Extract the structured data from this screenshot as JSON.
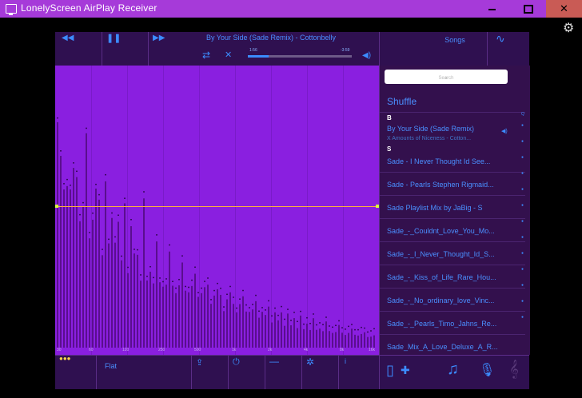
{
  "window": {
    "title": "LonelyScreen AirPlay Receiver",
    "close_label": "✕"
  },
  "player": {
    "now_playing": "By Your Side (Sade Remix) - Cottonbelly",
    "elapsed": "1:56",
    "remaining": "-3:59",
    "progress": 0.2,
    "songs_label": "Songs"
  },
  "spectrum": {
    "freq_labels": [
      "30",
      "60",
      "120",
      "250",
      "500",
      "1k",
      "2k",
      "4k",
      "8k",
      "16k"
    ]
  },
  "library": {
    "search_placeholder": "Search",
    "shuffle": "Shuffle",
    "section_b": "B",
    "section_s": "S",
    "current": {
      "title": "By Your Side (Sade Remix)",
      "subtitle": "X Amounts of Niceness - Cotton..."
    },
    "items": [
      "Sade - I Never Thought Id See...",
      "Sade - Pearls Stephen Rigmaid...",
      "Sade Playlist Mix by JaBig - S",
      "Sade_-_Couldnt_Love_You_Mo...",
      "Sade_-_I_Never_Thought_Id_S...",
      "Sade_-_Kiss_of_Life_Rare_Hou...",
      "Sade_-_No_ordinary_love_Vinc...",
      "Sade_-_Pearls_Timo_Jahns_Re...",
      "Sade_Mix_A_Love_Deluxe_A_R..."
    ]
  },
  "bottom": {
    "preset": "Flat"
  },
  "colors": {
    "title_bar": "#a63ad9",
    "accent": "#3c8cff",
    "spectrum": "#8a1fe0"
  },
  "icons": [
    "rewind",
    "pause",
    "fast-forward",
    "repeat",
    "shuffle",
    "volume",
    "wave",
    "gear",
    "share",
    "power",
    "minus",
    "settings",
    "info",
    "device",
    "music-note",
    "microphone",
    "treble-clef"
  ]
}
